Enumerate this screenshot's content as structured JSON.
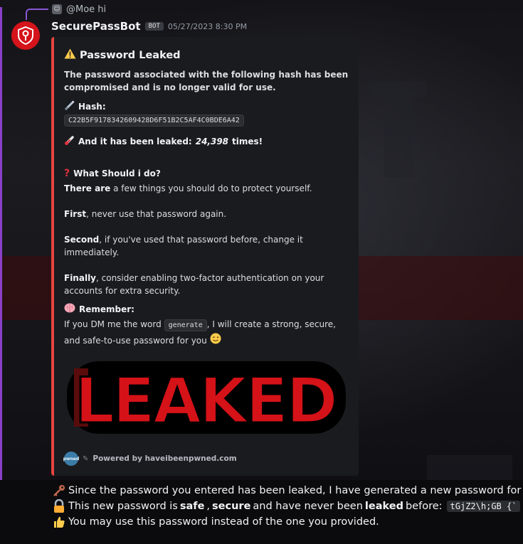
{
  "reply": {
    "avatar_glyph": "☺",
    "text": "@Moe hi"
  },
  "message": {
    "username": "SecurePassBot",
    "bot_tag": "BOT",
    "timestamp": "05/27/2023 8:30 PM",
    "avatar_color": "#d5131b"
  },
  "embed": {
    "accent_color": "#e5443f",
    "title": "Password Leaked",
    "description": "The password associated with the following hash has been compromised and is no longer valid for use.",
    "hash_label": "Hash:",
    "hash_value": "C22B5F9178342609428D6F51B2C5AF4C0BDE6A42",
    "leaked_prefix": "And it has been leaked:",
    "leaked_count": "24,398",
    "leaked_suffix": "times!",
    "what_heading": "What Should i do?",
    "p1_bold": "There are",
    "p1_rest": " a few things you should do to protect yourself.",
    "p2_bold": "First",
    "p2_rest": ", never use that password again.",
    "p3_bold": "Second",
    "p3_rest": ", if you've used that password before, change it immediately.",
    "p4_bold": "Finally",
    "p4_rest": ", consider enabling two-factor authentication on your accounts for extra security.",
    "remember_heading": "Remember:",
    "p5_pre": "If you DM me the word ",
    "p5_code": "generate",
    "p5_post": ", I will create a strong, secure, and safe-to-use password for you",
    "image_text": "LEAKED",
    "footer_icon_text": "pwned",
    "footer_text": "Powered by haveibeenpwned.com"
  },
  "followup": {
    "line1": "Since the password you entered has been leaked, I have generated a new password for you.",
    "line2_pre": "This new password is ",
    "line2_safe": "safe",
    "line2_comma": ", ",
    "line2_secure": "secure",
    "line2_mid": " and have never been ",
    "line2_leaked": "leaked",
    "line2_post": " before:",
    "password": "tGjZ2\\h;GB {`",
    "line3": "You may use this password instead of the one you provided."
  },
  "icons": {
    "title": "warning-icon",
    "hash": "syringe-icon",
    "leaked": "thermometer-icon",
    "what": "question-icon",
    "remember": "brain-icon",
    "wink": "wink-emoji-icon",
    "key": "key-icon",
    "lock": "lock-icon",
    "thumbs": "thumbs-up-icon"
  }
}
